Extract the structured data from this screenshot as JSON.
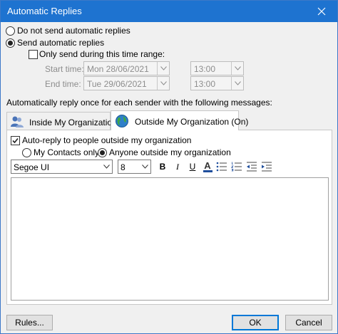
{
  "window": {
    "title": "Automatic Replies"
  },
  "options": {
    "do_not_send": "Do not send automatic replies",
    "send": "Send automatic replies",
    "time_range": "Only send during this time range:",
    "start_label": "Start time:",
    "start_date": "Mon 28/06/2021",
    "start_time": "13:00",
    "end_label": "End time:",
    "end_date": "Tue 29/06/2021",
    "end_time": "13:00",
    "selected": "send"
  },
  "instructions": "Automatically reply once for each sender with the following messages:",
  "tabs": [
    {
      "label": "Inside My Organization",
      "icon": "people-icon",
      "active": false
    },
    {
      "label": "Outside My Organization (On)",
      "icon": "globe-icon",
      "active": true
    }
  ],
  "outside": {
    "auto_reply_label": "Auto-reply to people outside my organization",
    "contacts_only": "My Contacts only",
    "anyone_outside": "Anyone outside my organization",
    "selected": "anyone"
  },
  "format_toolbar": {
    "font": "Segoe UI",
    "size": "8",
    "bold": "B",
    "italic": "I",
    "underline": "U",
    "font_color": "A",
    "accent_color": "#1f4e9c"
  },
  "buttons": {
    "rules": "Rules...",
    "ok": "OK",
    "cancel": "Cancel"
  }
}
